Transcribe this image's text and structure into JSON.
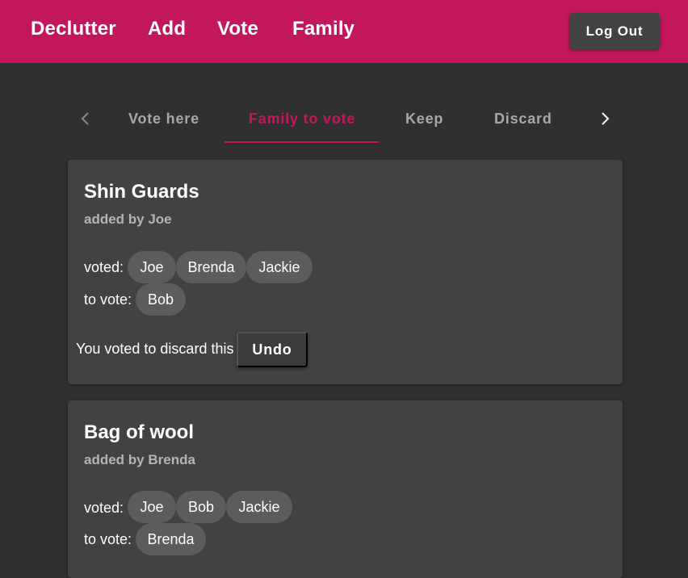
{
  "nav": {
    "links": [
      "Declutter",
      "Add",
      "Vote",
      "Family"
    ],
    "logout_label": "Log Out"
  },
  "tabs": {
    "items": [
      "Vote here",
      "Family to vote",
      "Keep",
      "Discard"
    ],
    "active": "Family to vote",
    "left_arrow_icon": "chevron-left-icon",
    "right_arrow_icon": "chevron-right-icon"
  },
  "cards": [
    {
      "title": "Shin Guards",
      "added_by": "added by Joe",
      "voted_label": "voted:",
      "voted": [
        "Joe",
        "Brenda",
        "Jackie"
      ],
      "to_vote_label": "to vote:",
      "to_vote": [
        "Bob"
      ],
      "vote_message": "You voted to discard this",
      "undo_label": "Undo"
    },
    {
      "title": "Bag of wool",
      "added_by": "added by Brenda",
      "voted_label": "voted:",
      "voted": [
        "Joe",
        "Bob",
        "Jackie"
      ],
      "to_vote_label": "to vote:",
      "to_vote": [
        "Brenda"
      ]
    }
  ],
  "colors": {
    "primary": "#c2185b",
    "background": "#303030",
    "card": "#424242",
    "chip": "#5c5c5c"
  }
}
